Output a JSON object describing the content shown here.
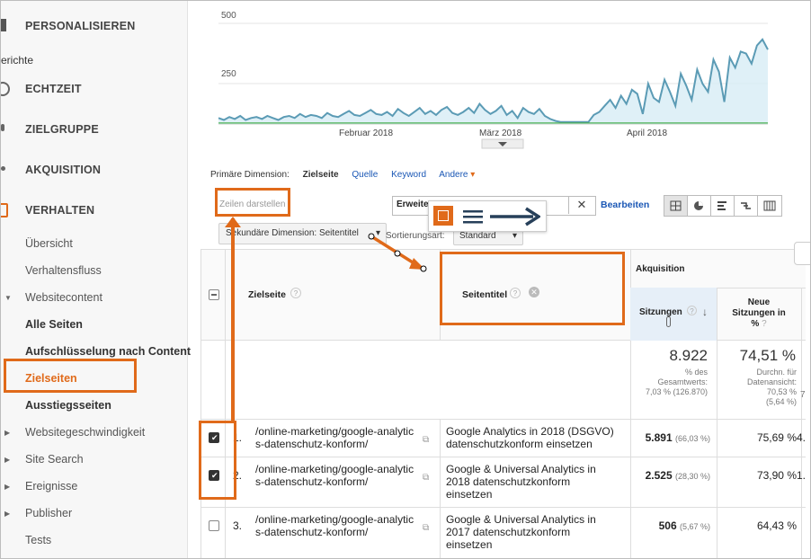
{
  "sidebar": {
    "personalisieren": "PERSONALISIEREN",
    "berichte": "erichte",
    "echtzeit": "ECHTZEIT",
    "zielgruppe": "ZIELGRUPPE",
    "akquisition": "AKQUISITION",
    "verhalten": "VERHALTEN",
    "items": [
      {
        "label": "Übersicht"
      },
      {
        "label": "Verhaltensfluss"
      },
      {
        "label": "Websitecontent"
      },
      {
        "label": "Alle Seiten"
      },
      {
        "label": "Aufschlüsselung nach Content"
      },
      {
        "label": "Zielseiten"
      },
      {
        "label": "Ausstiegsseiten"
      },
      {
        "label": "Websitegeschwindigkeit"
      },
      {
        "label": "Site Search"
      },
      {
        "label": "Ereignisse"
      },
      {
        "label": "Publisher"
      },
      {
        "label": "Tests"
      }
    ]
  },
  "chart_data": {
    "type": "line",
    "x_labels": [
      "Februar 2018",
      "März 2018",
      "April 2018"
    ],
    "y_ticks": [
      "500",
      "250"
    ],
    "ylim": [
      0,
      500
    ],
    "series": [
      {
        "values": [
          30,
          20,
          35,
          25,
          40,
          20,
          30,
          35,
          25,
          40,
          30,
          20,
          35,
          40,
          30,
          50,
          35,
          45,
          40,
          30,
          55,
          40,
          35,
          50,
          65,
          45,
          40,
          55,
          70,
          50,
          45,
          60,
          40,
          75,
          55,
          40,
          60,
          80,
          50,
          65,
          45,
          70,
          85,
          55,
          45,
          60,
          80,
          55,
          100,
          70,
          50,
          65,
          90,
          45,
          65,
          30,
          80,
          60,
          50,
          75,
          40,
          25,
          15,
          10,
          10,
          10,
          10,
          10,
          10,
          45,
          60,
          90,
          120,
          80,
          140,
          100,
          170,
          150,
          50,
          200,
          130,
          110,
          220,
          160,
          90,
          250,
          190,
          120,
          270,
          200,
          160,
          320,
          260,
          110,
          330,
          280,
          360,
          350,
          300,
          390,
          420,
          370
        ]
      },
      {
        "values": [
          5,
          5,
          5,
          5,
          5,
          5,
          5,
          5,
          5,
          5,
          5,
          5,
          5,
          5,
          5,
          5,
          5,
          5,
          5,
          5,
          5,
          5,
          5,
          5,
          5,
          5,
          5,
          5,
          5,
          5,
          5,
          5,
          5,
          5,
          5,
          5,
          5,
          5,
          5,
          5,
          5,
          5,
          5,
          5,
          5,
          5,
          5,
          5,
          5,
          5,
          5,
          5,
          5,
          5,
          5,
          5,
          5,
          5,
          5,
          5,
          5,
          5,
          5,
          5,
          5,
          5,
          5,
          5,
          5,
          5,
          5,
          5,
          5,
          5,
          5,
          5,
          5,
          5,
          5,
          5,
          5,
          5,
          5,
          5,
          5,
          5,
          5,
          5,
          5,
          5,
          5,
          5,
          5,
          5,
          5,
          5,
          5,
          5,
          5,
          5,
          5,
          5
        ]
      }
    ]
  },
  "dims": {
    "primary_label": "Primäre Dimension:",
    "zielseite": "Zielseite",
    "quelle": "Quelle",
    "keyword": "Keyword",
    "andere": "Andere"
  },
  "toolbar": {
    "zeilen": "Zeilen darstellen",
    "erweitert": "Erweitert",
    "bearbeiten": "Bearbeiten",
    "sek_dim": "Sekundäre Dimension: Seitentitel",
    "sortierungsart": "Sortierungsart:",
    "standard": "Standard"
  },
  "table": {
    "header": {
      "akquisition": "Akquisition",
      "zielseite": "Zielseite",
      "seitentitel": "Seitentitel",
      "sitzungen": "Sitzungen",
      "neue_sitzungen_1": "Neue",
      "neue_sitzungen_2": "Sitzungen in",
      "neue_sitzungen_3": "%"
    },
    "totals": {
      "sitzungen": "8.922",
      "sitzungen_sub1": "% des",
      "sitzungen_sub2": "Gesamtwerts:",
      "sitzungen_sub3": "7,03 % (126.870)",
      "neue": "74,51 %",
      "neue_sub1": "Durchn. für",
      "neue_sub2": "Datenansicht:",
      "neue_sub3": "70,53 %",
      "neue_sub4": "(5,64 %)",
      "extra": "7"
    },
    "rows": [
      {
        "num": "1.",
        "page1": "/online-marketing/google-analytic",
        "page2": "s-datenschutz-konform/",
        "t1": "Google Analytics in 2018 (DSGVO)",
        "t2": "datenschutzkonform einsetzen",
        "t3": "",
        "sess": "5.891",
        "pct": "(66,03 %)",
        "neu": "75,69 %",
        "extra": "4."
      },
      {
        "num": "2.",
        "page1": "/online-marketing/google-analytic",
        "page2": "s-datenschutz-konform/",
        "t1": "Google & Universal Analytics in",
        "t2": "2018 datenschutzkonform",
        "t3": "einsetzen",
        "sess": "2.525",
        "pct": "(28,30 %)",
        "neu": "73,90 %",
        "extra": "1."
      },
      {
        "num": "3.",
        "page1": "/online-marketing/google-analytic",
        "page2": "s-datenschutz-konform/",
        "t1": "Google & Universal Analytics in",
        "t2": "2017 datenschutzkonform",
        "t3": "einsetzen",
        "sess": "506",
        "pct": "(5,67 %)",
        "neu": "64,43 %",
        "extra": ""
      }
    ]
  },
  "colors": {
    "accent": "#e06a1a",
    "link": "#1a57b5",
    "chart_fill": "#d7ecf5",
    "chart_line": "#5b9bb5",
    "chart_line_green": "#4caf50"
  }
}
